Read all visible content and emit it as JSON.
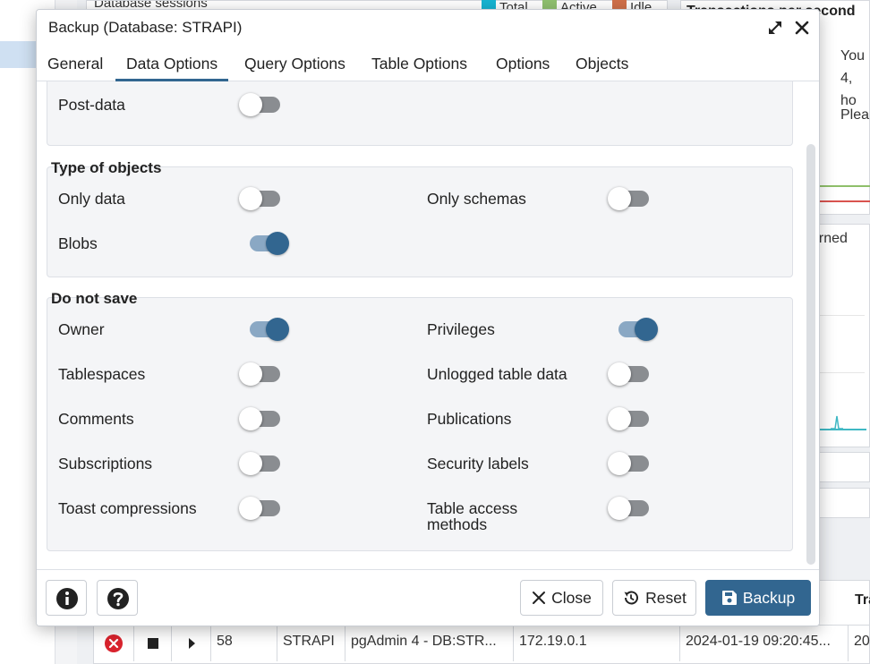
{
  "background": {
    "top_panel_title": "Database sessions",
    "legend": [
      {
        "label": "Total",
        "color": "#17b4d2"
      },
      {
        "label": "Active",
        "color": "#90c070"
      },
      {
        "label": "Idle",
        "color": "#d0704a"
      }
    ],
    "right_panel_title": "Transactions per second",
    "right_text_line1": "You",
    "right_text_line2": "4, ho",
    "right_text_line3": "Plea",
    "right_panel2_label": "urned",
    "table_header_partial": "Tra",
    "row": {
      "pid": "58",
      "database": "STRAPI",
      "application": "pgAdmin 4 - DB:STR...",
      "client": "172.19.0.1",
      "backend_start": "2024-01-19 09:20:45...",
      "xact_start": "20"
    }
  },
  "dialog": {
    "title": "Backup (Database: STRAPI)",
    "tabs": [
      {
        "label": "General",
        "active": false
      },
      {
        "label": "Data Options",
        "active": true
      },
      {
        "label": "Query Options",
        "active": false
      },
      {
        "label": "Table Options",
        "active": false
      },
      {
        "label": "Options",
        "active": false
      },
      {
        "label": "Objects",
        "active": false
      }
    ],
    "sections_partial": {
      "post_data": {
        "label": "Post-data",
        "on": false
      }
    },
    "type_of_objects": {
      "legend": "Type of objects",
      "only_data": {
        "label": "Only data",
        "on": false
      },
      "only_schemas": {
        "label": "Only schemas",
        "on": false
      },
      "blobs": {
        "label": "Blobs",
        "on": true
      }
    },
    "do_not_save": {
      "legend": "Do not save",
      "owner": {
        "label": "Owner",
        "on": true
      },
      "privileges": {
        "label": "Privileges",
        "on": true
      },
      "tablespaces": {
        "label": "Tablespaces",
        "on": false
      },
      "unlogged": {
        "label": "Unlogged table data",
        "on": false
      },
      "comments": {
        "label": "Comments",
        "on": false
      },
      "publications": {
        "label": "Publications",
        "on": false
      },
      "subscriptions": {
        "label": "Subscriptions",
        "on": false
      },
      "security_labels": {
        "label": "Security labels",
        "on": false
      },
      "toast": {
        "label": "Toast compressions",
        "on": false
      },
      "table_access_line1": "Table access",
      "table_access_line2": "methods",
      "table_access_on": false
    },
    "footer": {
      "close_label": "Close",
      "reset_label": "Reset",
      "backup_label": "Backup"
    }
  },
  "colors": {
    "accent": "#326690",
    "toggle_off": "#8a8d91",
    "danger": "#d9232d"
  }
}
